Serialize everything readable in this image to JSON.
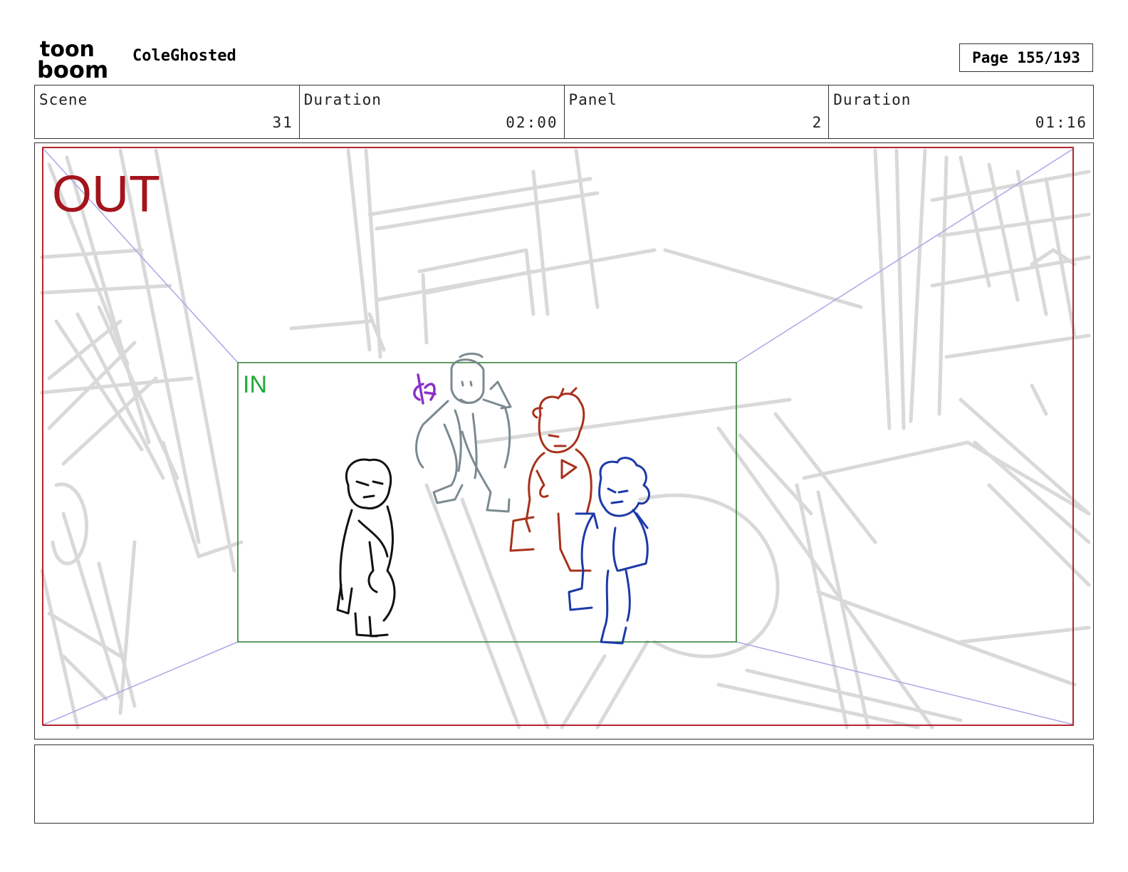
{
  "header": {
    "logo_text_line1": "toon",
    "logo_text_line2": "boom",
    "project_title": "ColeGhosted",
    "page_label": "Page 155/193"
  },
  "info": {
    "scene_label": "Scene",
    "scene_value": "31",
    "scene_duration_label": "Duration",
    "scene_duration_value": "02:00",
    "panel_label": "Panel",
    "panel_value": "2",
    "panel_duration_label": "Duration",
    "panel_duration_value": "01:16"
  },
  "panel": {
    "out_label": "OUT",
    "in_label": "IN",
    "colors": {
      "out_frame": "#b3262d",
      "in_frame": "#2e7d32",
      "in_text": "#22a83a",
      "perspective": "#a9a8e6",
      "background_sketch": "#d9d9d9",
      "character_black": "#111111",
      "character_grey": "#7b8a91",
      "character_red": "#a8321c",
      "character_blue": "#1c3aa8",
      "prop_purple": "#8a2fc9"
    }
  },
  "notes": {
    "text": ""
  }
}
